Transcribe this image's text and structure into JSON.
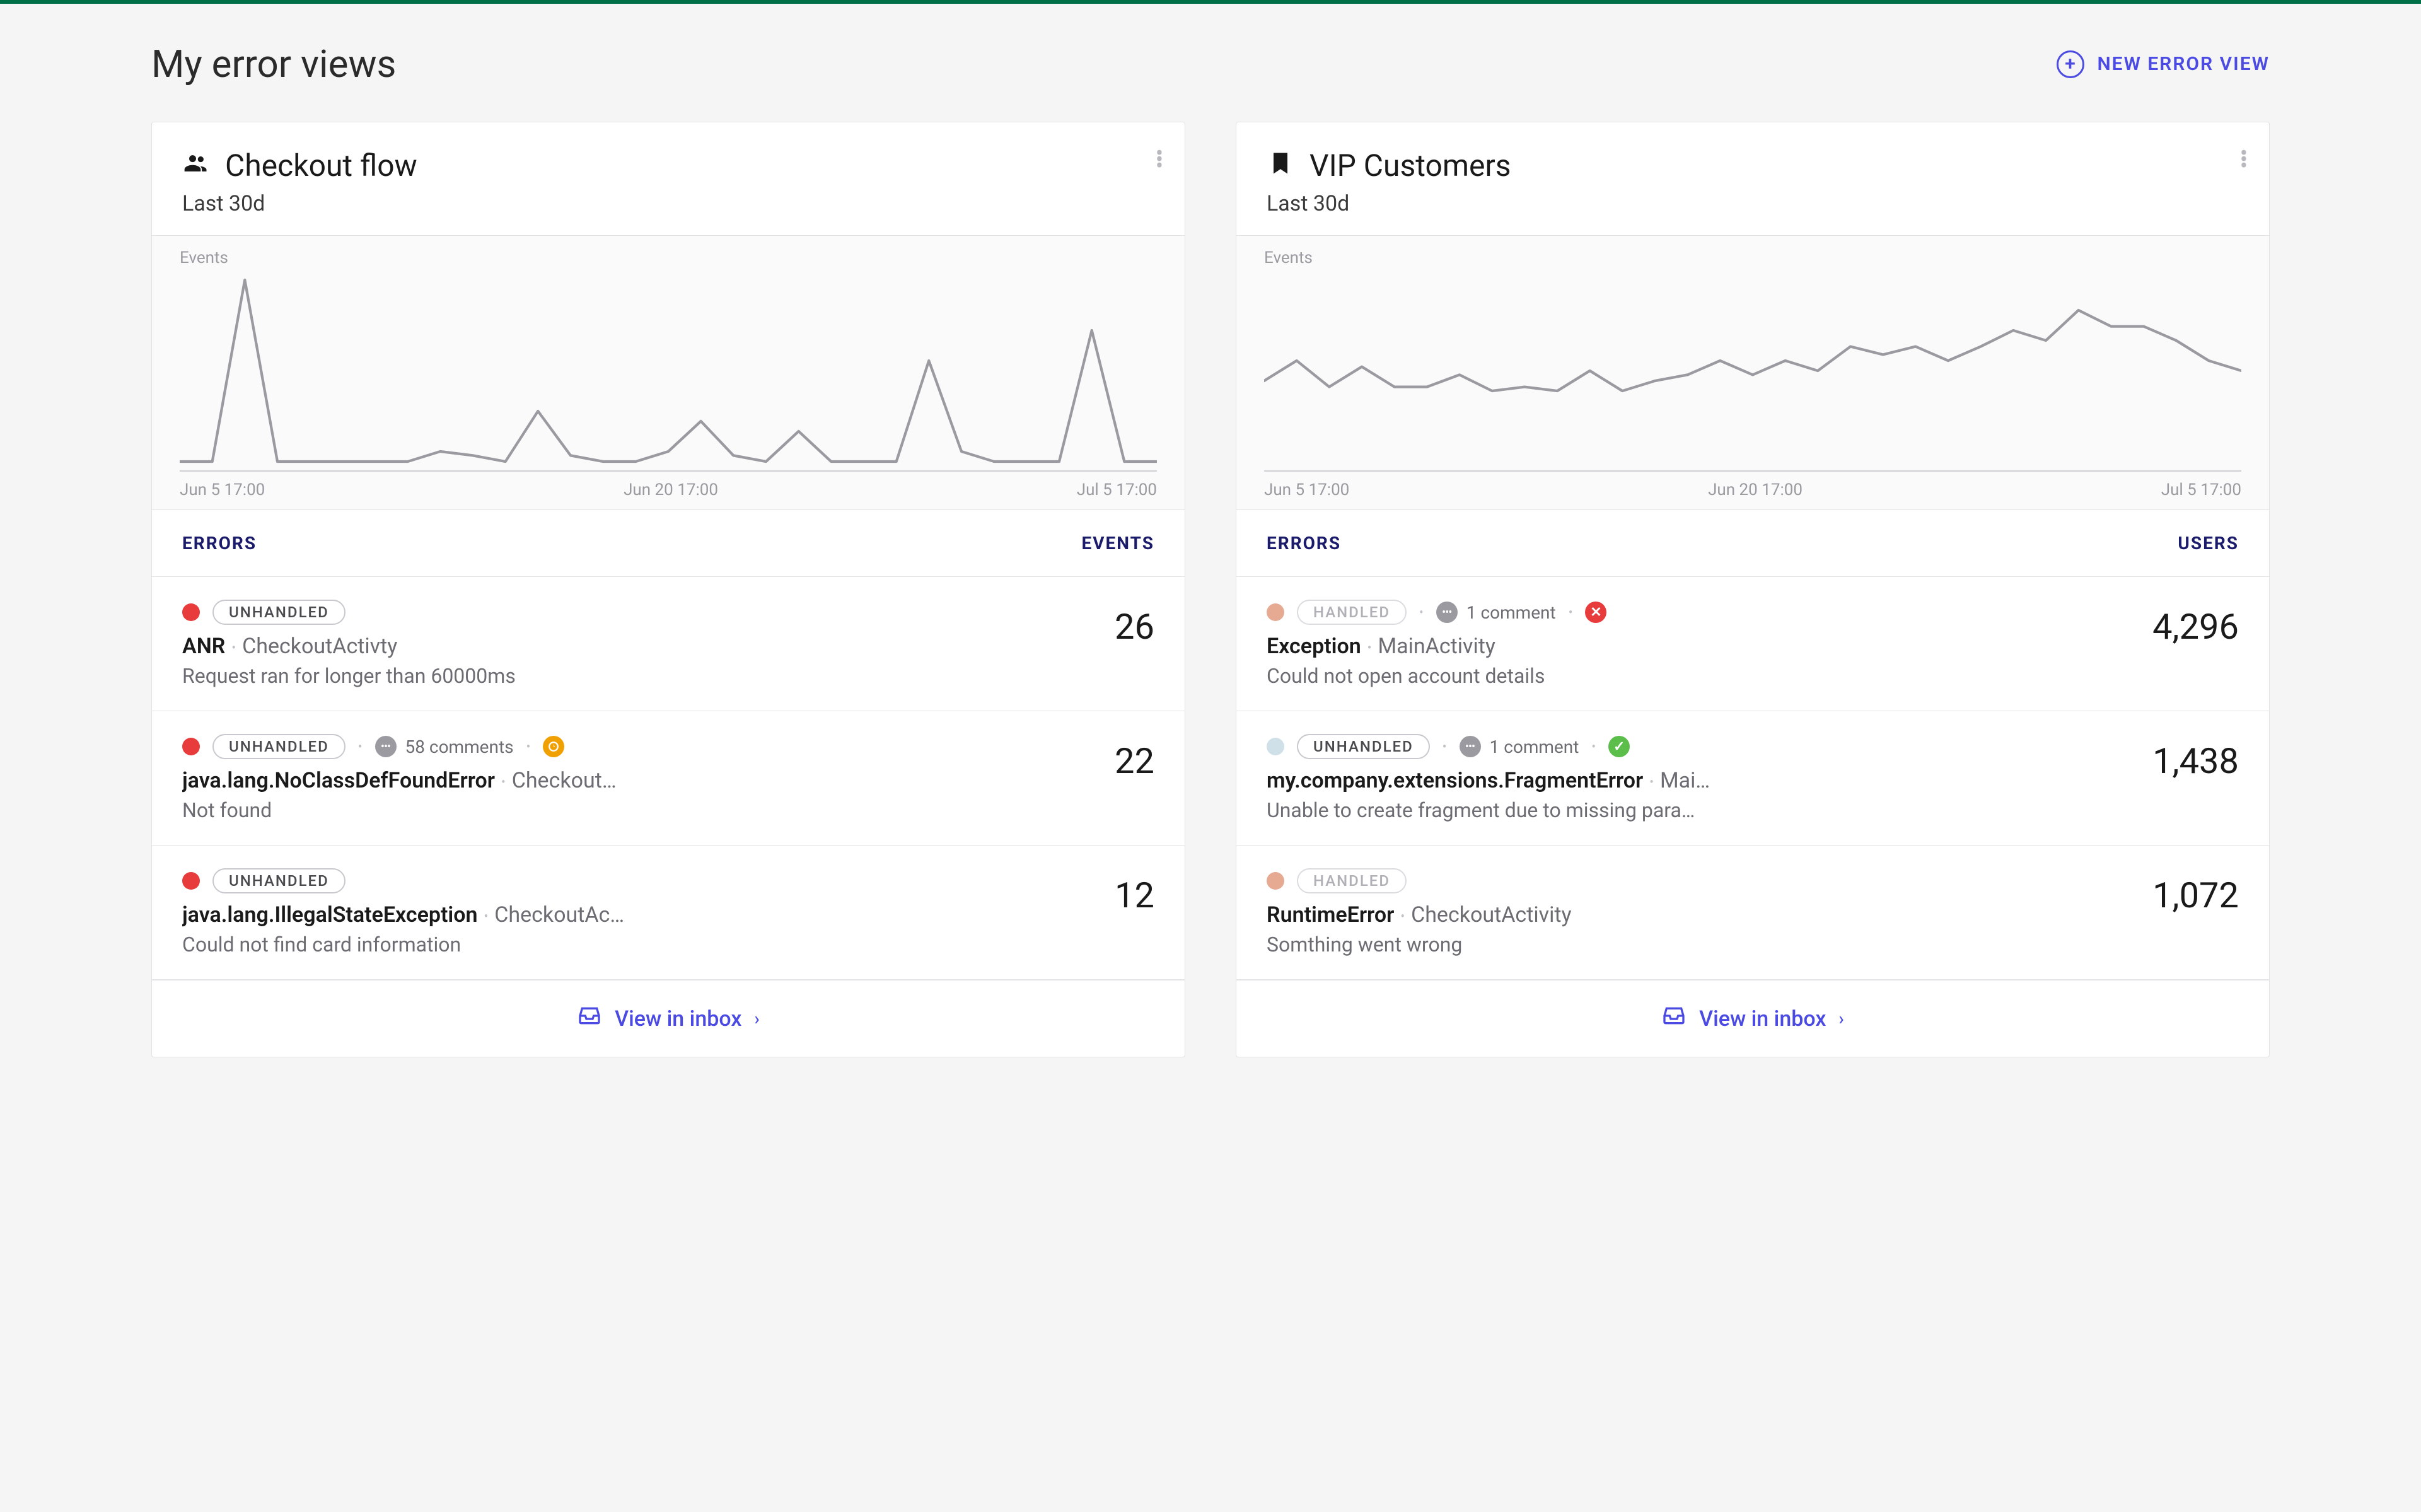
{
  "page_title": "My error views",
  "new_view_label": "NEW ERROR VIEW",
  "cards": [
    {
      "icon": "team",
      "title": "Checkout flow",
      "subtitle": "Last 30d",
      "chart_ylabel": "Events",
      "xticks": [
        "Jun 5 17:00",
        "Jun 20 17:00",
        "Jul 5 17:00"
      ],
      "col1": "ERRORS",
      "col2": "EVENTS",
      "rows": [
        {
          "severity": "red",
          "handled_label": "UNHANDLED",
          "handled_faded": false,
          "comments": null,
          "status": null,
          "name": "ANR",
          "context": "CheckoutActivty",
          "desc": "Request ran for longer than 60000ms",
          "value": "26"
        },
        {
          "severity": "red",
          "handled_label": "UNHANDLED",
          "handled_faded": false,
          "comments": "58 comments",
          "status": "snoozed",
          "name": "java.lang.NoClassDefFoundError",
          "context": "Checkout…",
          "desc": "Not found",
          "value": "22"
        },
        {
          "severity": "red",
          "handled_label": "UNHANDLED",
          "handled_faded": false,
          "comments": null,
          "status": null,
          "name": "java.lang.IllegalStateException",
          "context": "CheckoutAc…",
          "desc": "Could not find card information",
          "value": "12"
        }
      ],
      "footer_label": "View in inbox"
    },
    {
      "icon": "bookmark",
      "title": "VIP Customers",
      "subtitle": "Last 30d",
      "chart_ylabel": "Events",
      "xticks": [
        "Jun 5 17:00",
        "Jun 20 17:00",
        "Jul 5 17:00"
      ],
      "col1": "ERRORS",
      "col2": "USERS",
      "rows": [
        {
          "severity": "peach",
          "handled_label": "HANDLED",
          "handled_faded": true,
          "comments": "1 comment",
          "status": "error",
          "name": "Exception",
          "context": "MainActivity",
          "desc": "Could not open account details",
          "value": "4,296"
        },
        {
          "severity": "lightblue",
          "handled_label": "UNHANDLED",
          "handled_faded": false,
          "comments": "1 comment",
          "status": "fixed",
          "name": "my.company.extensions.FragmentError",
          "context": "Mai…",
          "desc": "Unable to create fragment due to missing para…",
          "value": "1,438"
        },
        {
          "severity": "peach",
          "handled_label": "HANDLED",
          "handled_faded": true,
          "comments": null,
          "status": null,
          "name": "RuntimeError",
          "context": "CheckoutActivity",
          "desc": "Somthing went wrong",
          "value": "1,072"
        }
      ],
      "footer_label": "View in inbox"
    }
  ],
  "chart_data": [
    {
      "type": "line",
      "title": "Checkout flow",
      "ylabel": "Events",
      "xlabel": "",
      "x_range": [
        "Jun 5 17:00",
        "Jul 5 17:00"
      ],
      "x_ticks": [
        "Jun 5 17:00",
        "Jun 20 17:00",
        "Jul 5 17:00"
      ],
      "n_points": 31,
      "values": [
        5,
        5,
        95,
        5,
        5,
        5,
        5,
        5,
        10,
        8,
        5,
        30,
        8,
        5,
        5,
        10,
        25,
        8,
        5,
        20,
        5,
        5,
        5,
        55,
        10,
        5,
        5,
        5,
        70,
        5,
        5
      ],
      "ylim": [
        0,
        100
      ],
      "note": "values are relative magnitudes estimated from sparkline heights; no y-axis ticks visible"
    },
    {
      "type": "line",
      "title": "VIP Customers",
      "ylabel": "Events",
      "xlabel": "",
      "x_range": [
        "Jun 5 17:00",
        "Jul 5 17:00"
      ],
      "x_ticks": [
        "Jun 5 17:00",
        "Jun 20 17:00",
        "Jul 5 17:00"
      ],
      "n_points": 31,
      "values": [
        45,
        55,
        42,
        52,
        42,
        42,
        48,
        40,
        42,
        40,
        50,
        40,
        45,
        48,
        55,
        48,
        55,
        50,
        62,
        58,
        62,
        55,
        62,
        70,
        65,
        80,
        72,
        72,
        65,
        55,
        50
      ],
      "ylim": [
        0,
        100
      ],
      "note": "values are relative magnitudes estimated from sparkline heights; no y-axis ticks visible"
    }
  ]
}
